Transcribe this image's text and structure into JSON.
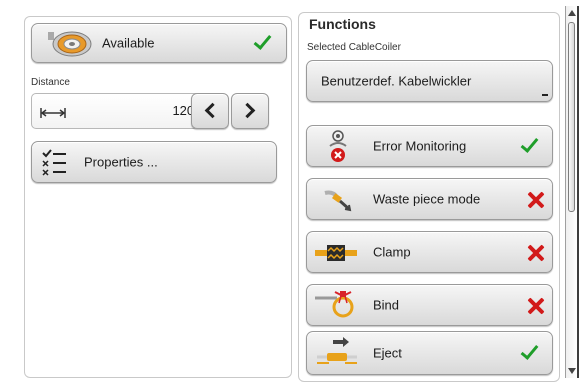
{
  "left": {
    "available_label": "Available",
    "distance_label": "Distance",
    "distance_value": "120.0",
    "properties_label": "Properties ..."
  },
  "right": {
    "title": "Functions",
    "coiler_label": "Selected CableCoiler",
    "coiler_value": "Benutzerdef. Kabelwickler",
    "functions": [
      {
        "label": "Error Monitoring",
        "icon": "error-monitoring-icon",
        "status": "enabled"
      },
      {
        "label": "Waste piece mode",
        "icon": "waste-piece-icon",
        "status": "disabled"
      },
      {
        "label": "Clamp",
        "icon": "clamp-icon",
        "status": "disabled"
      },
      {
        "label": "Bind",
        "icon": "bind-icon",
        "status": "disabled"
      },
      {
        "label": "Eject",
        "icon": "eject-icon",
        "status": "enabled"
      }
    ]
  },
  "colors": {
    "check": "#1f9e2a",
    "cross": "#d21a1a",
    "clamp_accent": "#e8a21a",
    "bind_accent": "#d8232a"
  }
}
